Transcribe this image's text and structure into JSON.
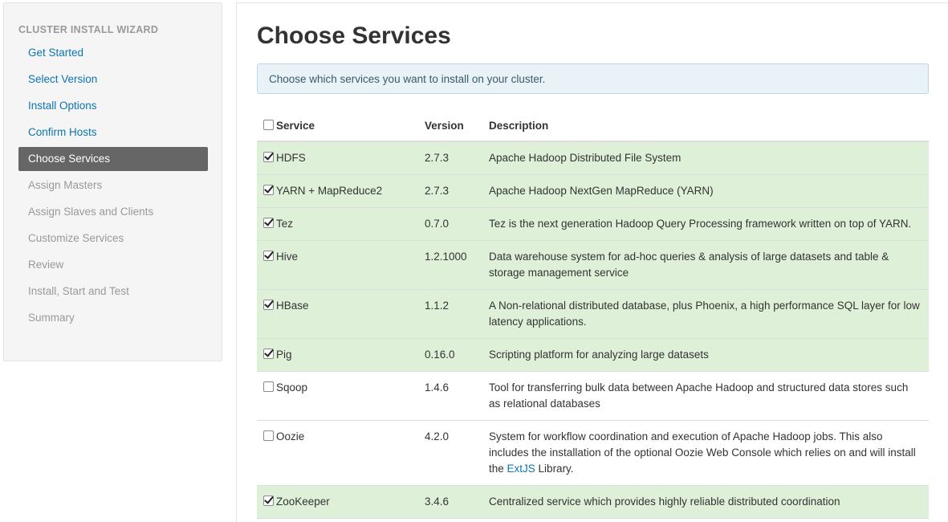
{
  "sidebar": {
    "header": "CLUSTER INSTALL WIZARD",
    "steps": [
      {
        "label": "Get Started",
        "state": "done"
      },
      {
        "label": "Select Version",
        "state": "done"
      },
      {
        "label": "Install Options",
        "state": "done"
      },
      {
        "label": "Confirm Hosts",
        "state": "done"
      },
      {
        "label": "Choose Services",
        "state": "active"
      },
      {
        "label": "Assign Masters",
        "state": "pending"
      },
      {
        "label": "Assign Slaves and Clients",
        "state": "pending"
      },
      {
        "label": "Customize Services",
        "state": "pending"
      },
      {
        "label": "Review",
        "state": "pending"
      },
      {
        "label": "Install, Start and Test",
        "state": "pending"
      },
      {
        "label": "Summary",
        "state": "pending"
      }
    ]
  },
  "main": {
    "title": "Choose Services",
    "info": "Choose which services you want to install on your cluster.",
    "table": {
      "headers": {
        "service": "Service",
        "version": "Version",
        "description": "Description"
      },
      "select_all_checked": false,
      "rows": [
        {
          "name": "HDFS",
          "version": "2.7.3",
          "description": "Apache Hadoop Distributed File System",
          "checked": true
        },
        {
          "name": "YARN + MapReduce2",
          "version": "2.7.3",
          "description": "Apache Hadoop NextGen MapReduce (YARN)",
          "checked": true
        },
        {
          "name": "Tez",
          "version": "0.7.0",
          "description": "Tez is the next generation Hadoop Query Processing framework written on top of YARN.",
          "checked": true
        },
        {
          "name": "Hive",
          "version": "1.2.1000",
          "description": "Data warehouse system for ad-hoc queries & analysis of large datasets and table & storage management service",
          "checked": true
        },
        {
          "name": "HBase",
          "version": "1.1.2",
          "description": "A Non-relational distributed database, plus Phoenix, a high performance SQL layer for low latency applications.",
          "checked": true
        },
        {
          "name": "Pig",
          "version": "0.16.0",
          "description": "Scripting platform for analyzing large datasets",
          "checked": true
        },
        {
          "name": "Sqoop",
          "version": "1.4.6",
          "description": "Tool for transferring bulk data between Apache Hadoop and structured data stores such as relational databases",
          "checked": false
        },
        {
          "name": "Oozie",
          "version": "4.2.0",
          "description_before": "System for workflow coordination and execution of Apache Hadoop jobs. This also includes the installation of the optional Oozie Web Console which relies on and will install the ",
          "description_link": "ExtJS",
          "description_after": " Library.",
          "checked": false
        },
        {
          "name": "ZooKeeper",
          "version": "3.4.6",
          "description": "Centralized service which provides highly reliable distributed coordination",
          "checked": true
        }
      ]
    }
  },
  "colors": {
    "link": "#0b75b1",
    "active_step_bg": "#666666",
    "selected_row_bg": "#dff0d8",
    "info_bg": "#e8f2f7"
  }
}
